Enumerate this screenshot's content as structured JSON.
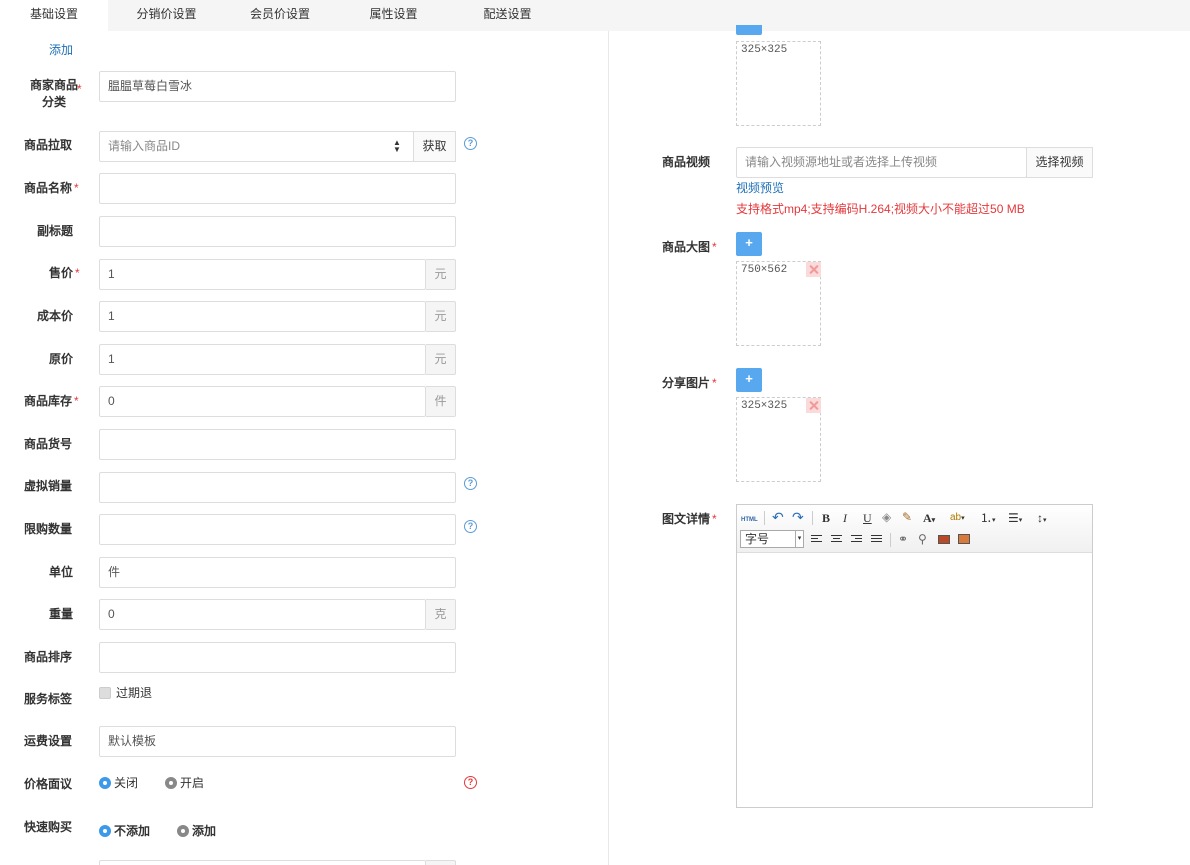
{
  "tabs": [
    "基础设置",
    "分销价设置",
    "会员价设置",
    "属性设置",
    "配送设置"
  ],
  "add_link": "添加",
  "form": {
    "category": {
      "label": "商家商品分类",
      "value": "腽腽草莓白雪冰"
    },
    "pull": {
      "label": "商品拉取",
      "placeholder": "请输入商品ID",
      "button": "获取",
      "help": "?"
    },
    "name": {
      "label": "商品名称",
      "value": ""
    },
    "subtitle": {
      "label": "副标题",
      "value": ""
    },
    "price": {
      "label": "售价",
      "value": "1",
      "unit": "元"
    },
    "cost": {
      "label": "成本价",
      "value": "1",
      "unit": "元"
    },
    "original": {
      "label": "原价",
      "value": "1",
      "unit": "元"
    },
    "stock": {
      "label": "商品库存",
      "value": "0",
      "unit": "件"
    },
    "sku": {
      "label": "商品货号",
      "value": ""
    },
    "virtual_sales": {
      "label": "虚拟销量",
      "value": "",
      "help": "?"
    },
    "limit": {
      "label": "限购数量",
      "value": "",
      "help": "?"
    },
    "unit": {
      "label": "单位",
      "value": "件"
    },
    "weight": {
      "label": "重量",
      "value": "0",
      "unit": "克"
    },
    "sort": {
      "label": "商品排序",
      "value": ""
    },
    "service": {
      "label": "服务标签",
      "option": "过期退"
    },
    "shipping": {
      "label": "运费设置",
      "value": "默认模板"
    },
    "negotiable": {
      "label": "价格面议",
      "options": [
        "关闭",
        "开启"
      ],
      "selected": "关闭",
      "help": "?"
    },
    "quick_buy": {
      "label": "快速购买",
      "options": [
        "不添加",
        "添加"
      ],
      "selected": "不添加"
    }
  },
  "right": {
    "thumb": {
      "size": "325×325"
    },
    "video": {
      "label": "商品视频",
      "placeholder": "请输入视频源地址或者选择上传视频",
      "button": "选择视频",
      "preview": "视频预览",
      "hint": "支持格式mp4;支持编码H.264;视频大小不能超过50 MB"
    },
    "large_image": {
      "label": "商品大图",
      "size": "750×562",
      "add": "+"
    },
    "share_image": {
      "label": "分享图片",
      "size": "325×325",
      "add": "+"
    },
    "detail": {
      "label": "图文详情",
      "fontsize_label": "字号",
      "html_btn": "HTML"
    }
  },
  "colors": {
    "accent": "#58a8ef",
    "required": "#e4393c",
    "link": "#1e6fb8"
  }
}
